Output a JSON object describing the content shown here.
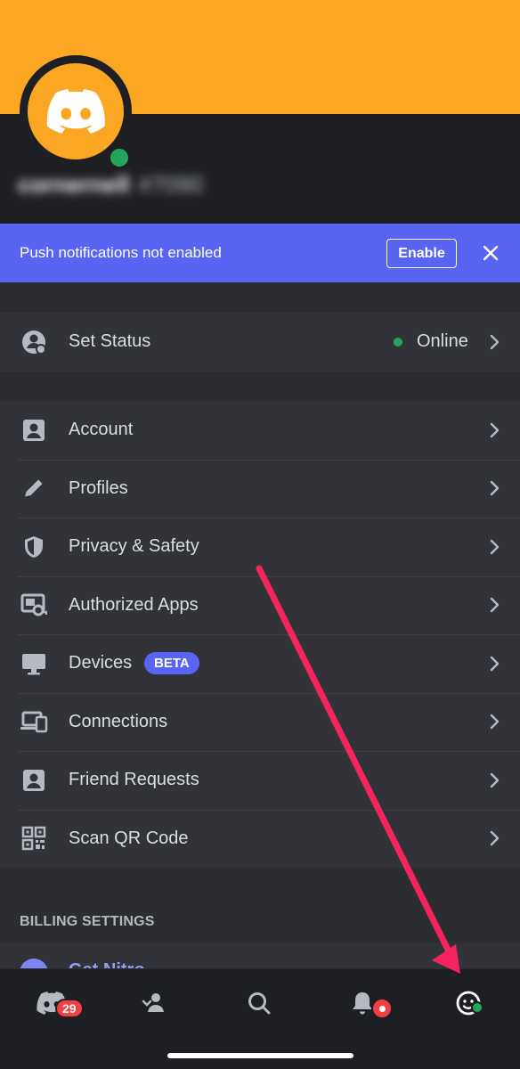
{
  "profile": {
    "username": "cornernell",
    "tag": "#7090",
    "status_color": "#23a55a",
    "banner_color": "#fba724"
  },
  "push_banner": {
    "message": "Push notifications not enabled",
    "enable_label": "Enable",
    "close_icon": "close-icon"
  },
  "status": {
    "label": "Set Status",
    "value": "Online",
    "icon": "status-icon"
  },
  "menu": [
    {
      "label": "Account",
      "icon": "account-icon"
    },
    {
      "label": "Profiles",
      "icon": "pencil-icon"
    },
    {
      "label": "Privacy & Safety",
      "icon": "shield-icon"
    },
    {
      "label": "Authorized Apps",
      "icon": "authorized-apps-icon"
    },
    {
      "label": "Devices",
      "icon": "monitor-icon",
      "badge": "BETA"
    },
    {
      "label": "Connections",
      "icon": "connections-icon"
    },
    {
      "label": "Friend Requests",
      "icon": "friend-requests-icon"
    },
    {
      "label": "Scan QR Code",
      "icon": "qr-code-icon"
    }
  ],
  "billing": {
    "section_title": "BILLING SETTINGS",
    "peek_label": "Get Nitro"
  },
  "tabs": [
    {
      "name": "home",
      "icon": "discord-home-icon",
      "badge": "29"
    },
    {
      "name": "friends",
      "icon": "friends-icon"
    },
    {
      "name": "search",
      "icon": "search-icon"
    },
    {
      "name": "notifications",
      "icon": "bell-icon",
      "has_dot": true
    },
    {
      "name": "you",
      "icon": "you-icon",
      "active": true
    }
  ],
  "colors": {
    "accent": "#5865f2",
    "online": "#23a55a",
    "danger": "#f23f43",
    "annotation_arrow": "#f5245f"
  }
}
